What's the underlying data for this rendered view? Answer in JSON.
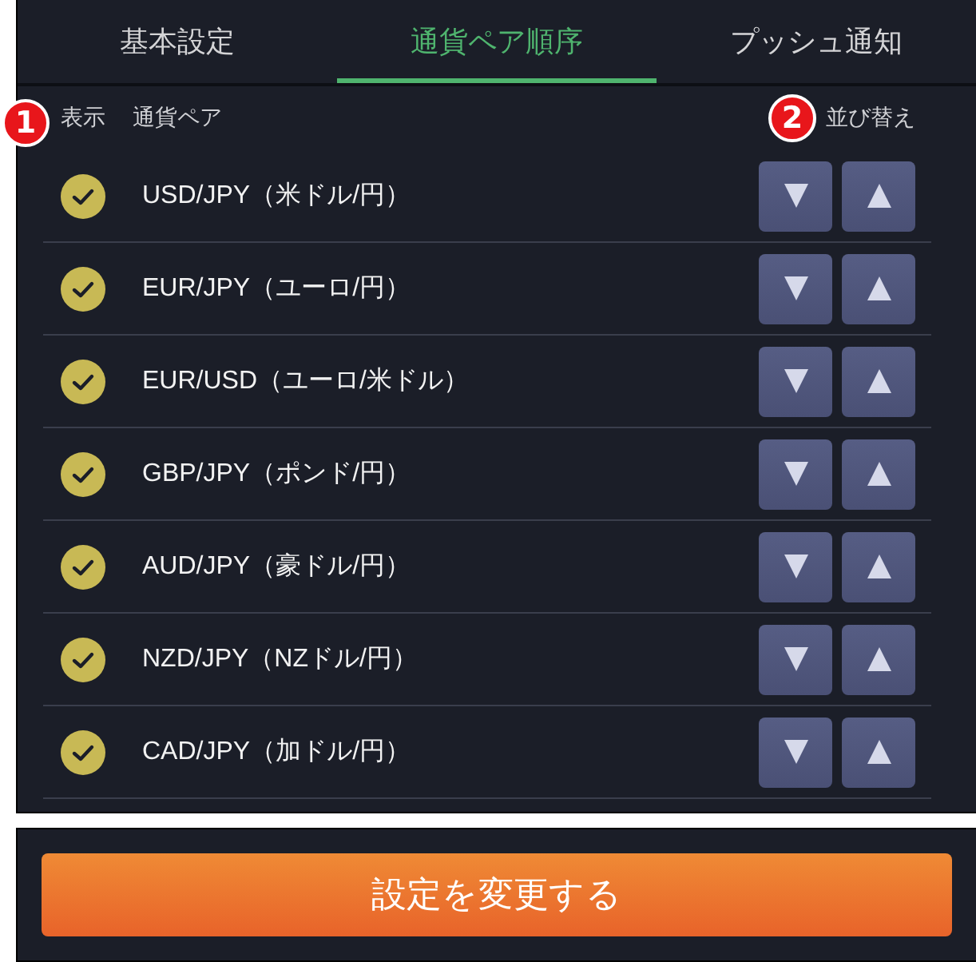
{
  "tabs": [
    {
      "label": "基本設定",
      "selected": false
    },
    {
      "label": "通貨ペア順序",
      "selected": true
    },
    {
      "label": "プッシュ通知",
      "selected": false
    }
  ],
  "header": {
    "display_marker": "1",
    "display_label": "表示",
    "pair_label": "通貨ペア",
    "sort_marker": "2",
    "sort_label": "並び替え"
  },
  "rows": [
    {
      "pair": "USD/JPY（米ドル/円）",
      "checked": true
    },
    {
      "pair": "EUR/JPY（ユーロ/円）",
      "checked": true
    },
    {
      "pair": "EUR/USD（ユーロ/米ドル）",
      "checked": true
    },
    {
      "pair": "GBP/JPY（ポンド/円）",
      "checked": true
    },
    {
      "pair": "AUD/JPY（豪ドル/円）",
      "checked": true
    },
    {
      "pair": "NZD/JPY（NZドル/円）",
      "checked": true
    },
    {
      "pair": "CAD/JPY（加ドル/円）",
      "checked": true
    }
  ],
  "submit_button": {
    "label": "設定を変更する"
  }
}
